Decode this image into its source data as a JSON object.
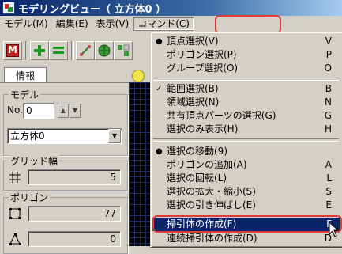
{
  "window": {
    "title": "モデリングビュー（ 立方体0 ）"
  },
  "menubar": [
    {
      "label": "モデル(M)"
    },
    {
      "label": "編集(E)"
    },
    {
      "label": "表示(V)"
    },
    {
      "label": "コマンド(C)"
    }
  ],
  "left_panel": {
    "tab_label": "情報",
    "model": {
      "label": "モデル",
      "no_label": "No.",
      "no_value": "0",
      "object_name": "立方体0"
    },
    "grid_width": {
      "label": "グリッド幅",
      "value": "5"
    },
    "polygon": {
      "label": "ポリゴン",
      "count1": "77",
      "count2": "0"
    }
  },
  "command_menu": {
    "items": [
      {
        "label": "頂点選択(V)",
        "key": "V",
        "mark": "●"
      },
      {
        "label": "ポリゴン選択(P)",
        "key": "P",
        "mark": ""
      },
      {
        "label": "グループ選択(O)",
        "key": "O",
        "mark": ""
      },
      {
        "label": "範囲選択(B)",
        "key": "B",
        "mark": "✓"
      },
      {
        "label": "領域選択(N)",
        "key": "N",
        "mark": ""
      },
      {
        "label": "共有頂点パーツの選択(G)",
        "key": "G",
        "mark": ""
      },
      {
        "label": "選択のみ表示(H)",
        "key": "H",
        "mark": ""
      },
      {
        "label": "選択の移動(9)",
        "key": "",
        "mark": "●"
      },
      {
        "label": "ポリゴンの追加(A)",
        "key": "A",
        "mark": ""
      },
      {
        "label": "選択の回転(L)",
        "key": "L",
        "mark": ""
      },
      {
        "label": "選択の拡大・縮小(S)",
        "key": "S",
        "mark": ""
      },
      {
        "label": "選択の引き伸ばし(E)",
        "key": "E",
        "mark": ""
      },
      {
        "label": "掃引体の作成(F)",
        "key": "F",
        "mark": ""
      },
      {
        "label": "連続掃引体の作成(D)",
        "key": "D",
        "mark": ""
      }
    ]
  },
  "colors": {
    "highlight": "#e03b3b",
    "menu_selected": "#0a246a",
    "title_bar": "#0a246a"
  },
  "icons": [
    "app-icon",
    "model-icon",
    "add-icon",
    "equal-icon",
    "bone-icon",
    "globe-icon",
    "bulb-icon",
    "grid-icon",
    "polygon-icon",
    "triangle-icon",
    "cursor-icon"
  ]
}
